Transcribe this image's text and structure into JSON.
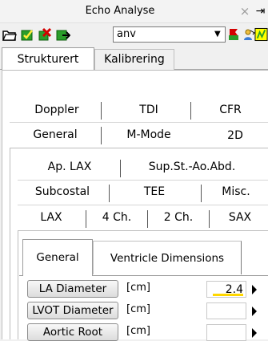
{
  "window": {
    "title": "Echo Analyse",
    "close_glyph": "×",
    "pin_glyph": "⇥"
  },
  "toolbar": {
    "icons": [
      "open-folder-icon",
      "save-check-icon",
      "delete-icon",
      "export-icon",
      "flag-icon",
      "people-icon",
      "highlight-icon"
    ],
    "combo_value": "anv"
  },
  "main_tabs": [
    {
      "label": "Strukturert"
    },
    {
      "label": "Kalibrering"
    }
  ],
  "mode_tabs": {
    "row1": [
      {
        "label": "Doppler"
      },
      {
        "label": "TDI"
      },
      {
        "label": "CFR"
      }
    ],
    "row2": [
      {
        "label": "General"
      },
      {
        "label": "M-Mode"
      },
      {
        "label": "2D"
      }
    ]
  },
  "view_tabs": {
    "row1": [
      {
        "label": "Ap. LAX"
      },
      {
        "label": "Sup.St.-Ao.Abd."
      }
    ],
    "row2": [
      {
        "label": "Subcostal"
      },
      {
        "label": "TEE"
      },
      {
        "label": "Misc."
      }
    ],
    "row3": [
      {
        "label": "LAX"
      },
      {
        "label": "4 Ch."
      },
      {
        "label": "2 Ch."
      },
      {
        "label": "SAX"
      }
    ]
  },
  "sub_tabs": [
    {
      "label": "General"
    },
    {
      "label": "Ventricle Dimensions"
    }
  ],
  "measurements": [
    {
      "label": "LA Diameter",
      "unit": "[cm]",
      "value": "2.4"
    },
    {
      "label": "LVOT Diameter",
      "unit": "[cm]",
      "value": ""
    },
    {
      "label": "Aortic Root",
      "unit": "[cm]",
      "value": ""
    }
  ]
}
